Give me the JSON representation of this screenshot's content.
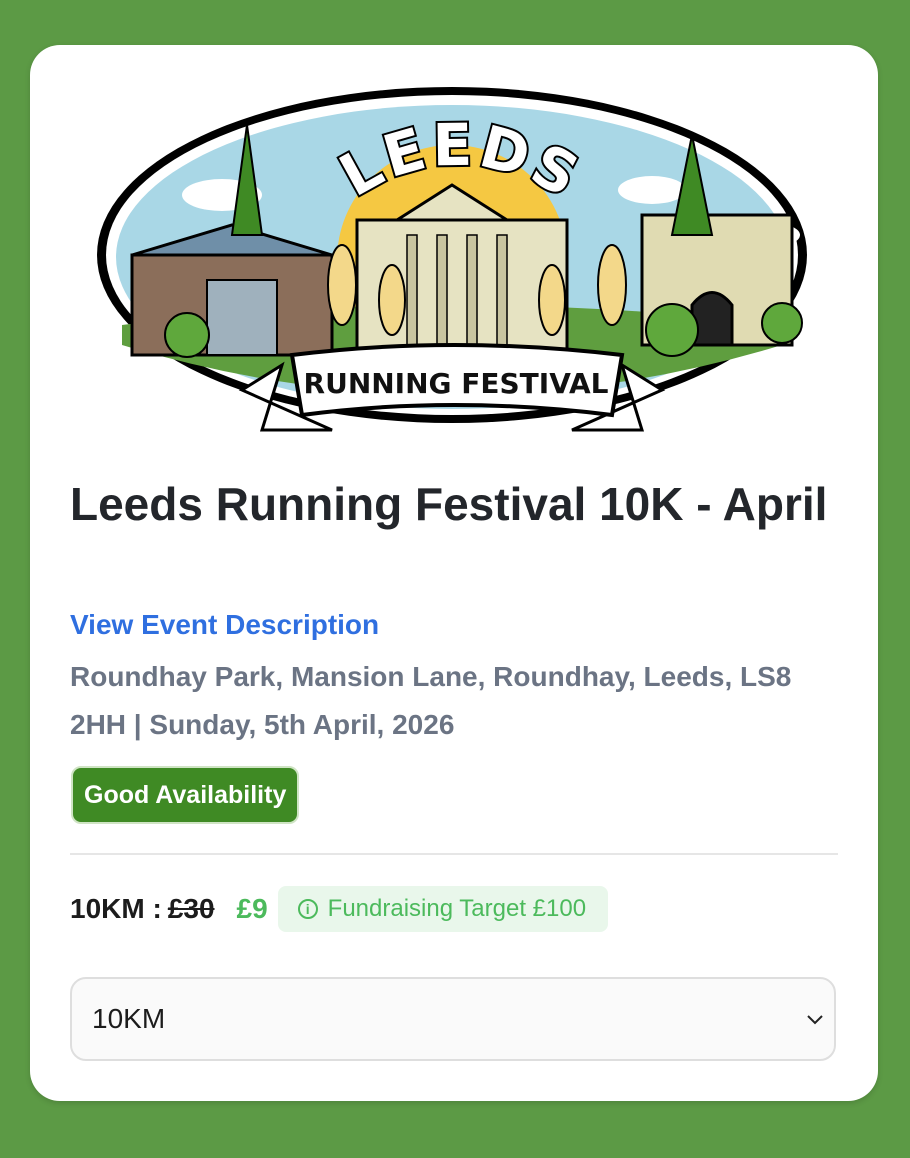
{
  "logo": {
    "top_text": "LEEDS",
    "banner_text": "RUNNING FESTIVAL"
  },
  "event": {
    "title": "Leeds Running Festival 10K - April",
    "description_link": "View Event Description",
    "location_date": "Roundhay Park, Mansion Lane, Roundhay, Leeds, LS8 2HH | Sunday, 5th April, 2026",
    "availability": "Good Availability"
  },
  "pricing": {
    "distance_label": "10KM :",
    "old_price": "£30",
    "new_price": "£9",
    "fundraising": "Fundraising Target £100",
    "info_icon": "i"
  },
  "select": {
    "value": "10KM",
    "icon": "chevron-down-icon"
  },
  "colors": {
    "background": "#5c9a45",
    "badge": "#3f8a24",
    "link": "#2f6fe0",
    "price_green": "#4cba5c"
  }
}
